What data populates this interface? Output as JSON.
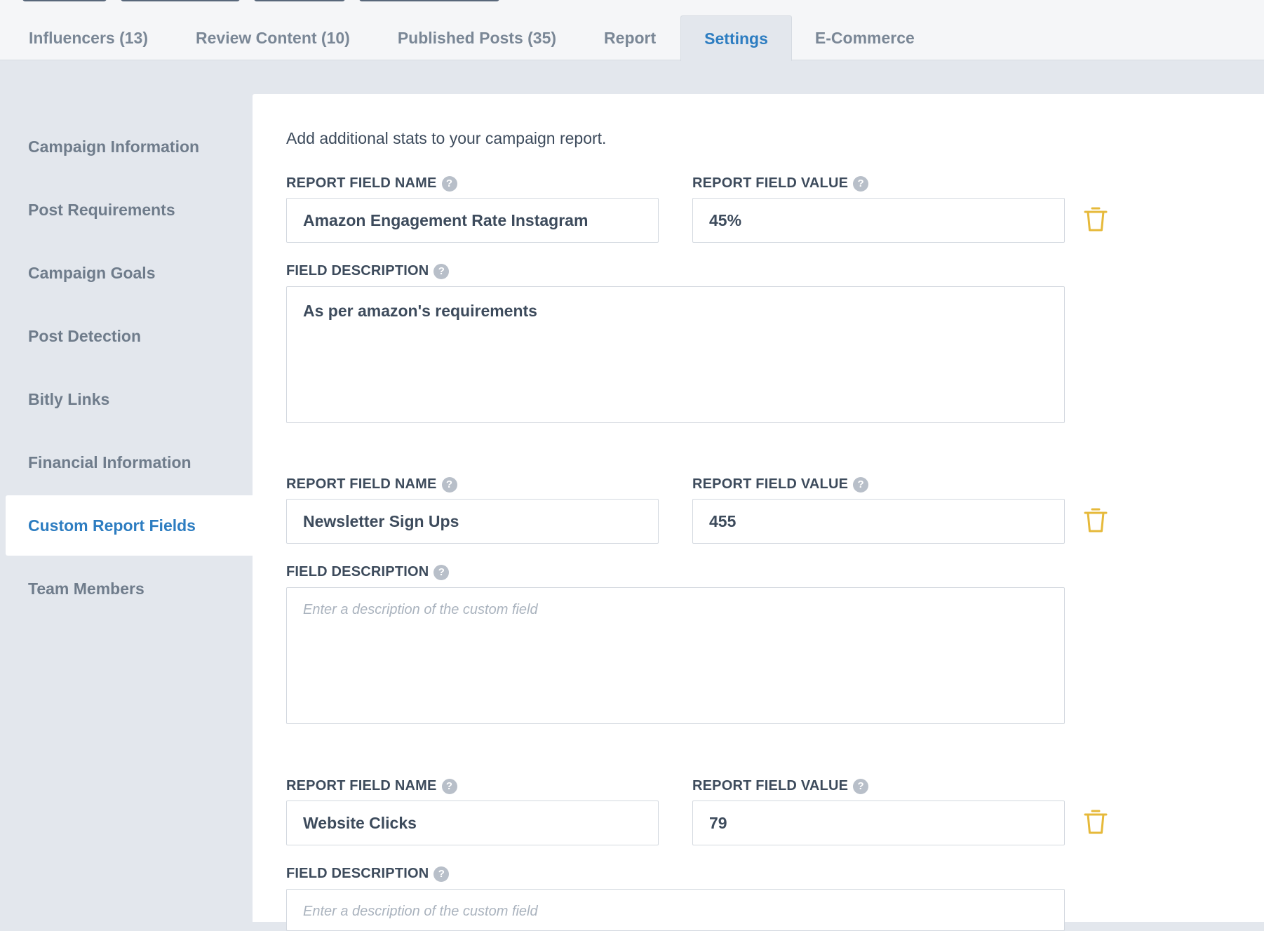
{
  "tabs": [
    {
      "label": "Influencers (13)"
    },
    {
      "label": "Review Content (10)"
    },
    {
      "label": "Published Posts (35)"
    },
    {
      "label": "Report"
    },
    {
      "label": "Settings",
      "active": true
    },
    {
      "label": "E-Commerce"
    }
  ],
  "sidebar": {
    "items": [
      {
        "label": "Campaign Information"
      },
      {
        "label": "Post Requirements"
      },
      {
        "label": "Campaign Goals"
      },
      {
        "label": "Post Detection"
      },
      {
        "label": "Bitly Links"
      },
      {
        "label": "Financial Information"
      },
      {
        "label": "Custom Report Fields",
        "active": true
      },
      {
        "label": "Team Members"
      }
    ]
  },
  "main": {
    "intro": "Add additional stats to your campaign report.",
    "labels": {
      "field_name": "REPORT FIELD NAME",
      "field_value": "REPORT FIELD VALUE",
      "field_description": "FIELD DESCRIPTION"
    },
    "description_placeholder": "Enter a description of the custom field",
    "fields": [
      {
        "name": "Amazon Engagement Rate Instagram",
        "value": "45%",
        "description": "As per amazon's requirements"
      },
      {
        "name": "Newsletter Sign Ups",
        "value": "455",
        "description": ""
      },
      {
        "name": "Website Clicks",
        "value": "79",
        "description": ""
      }
    ]
  },
  "colors": {
    "accent": "#2d7dc1",
    "trash": "#e6b93a",
    "background": "#e3e7ed"
  },
  "icons": {
    "help": "question-circle-icon",
    "delete": "trash-icon"
  }
}
